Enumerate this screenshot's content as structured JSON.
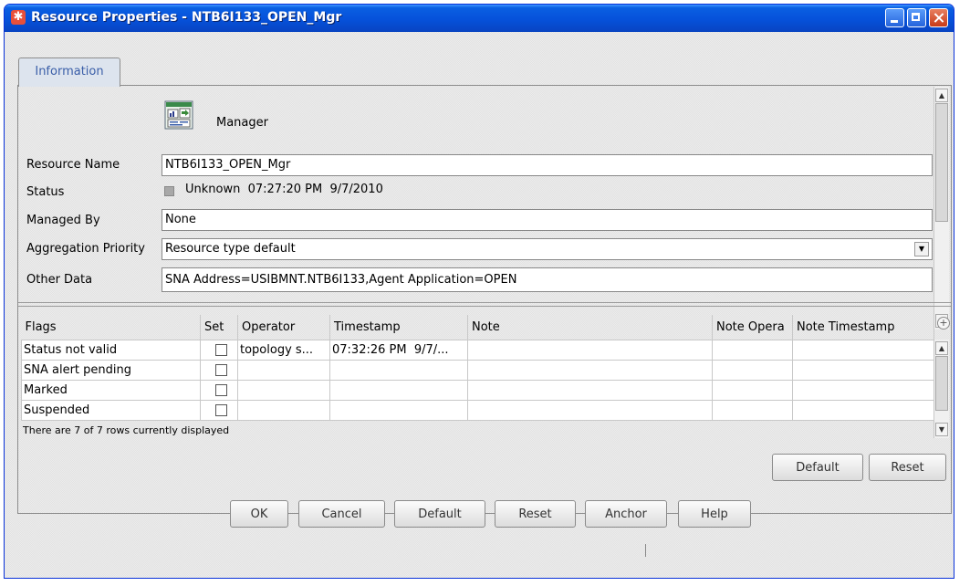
{
  "window": {
    "title": "Resource Properties - NTB6I133_OPEN_Mgr"
  },
  "tabs": [
    {
      "label": "Information"
    }
  ],
  "info": {
    "type_label": "Manager",
    "resource_name_label": "Resource Name",
    "resource_name_value": "NTB6I133_OPEN_Mgr",
    "status_label": "Status",
    "status_value": "Unknown  07:27:20 PM  9/7/2010",
    "status_color": "#a8a8a8",
    "managed_by_label": "Managed By",
    "managed_by_value": "None",
    "aggregation_priority_label": "Aggregation Priority",
    "aggregation_priority_value": "Resource type default",
    "other_data_label": "Other Data",
    "other_data_value": "SNA Address=USIBMNT.NTB6I133,Agent Application=OPEN"
  },
  "flags_table": {
    "columns": [
      "Flags",
      "Set",
      "Operator",
      "Timestamp",
      "Note",
      "Note Opera",
      "Note Timestamp"
    ],
    "rows": [
      {
        "flag": "Status not valid",
        "set": false,
        "operator": "topology s...",
        "timestamp": "07:32:26 PM  9/7/...",
        "note": "",
        "note_operator": "",
        "note_timestamp": ""
      },
      {
        "flag": "SNA alert pending",
        "set": false,
        "operator": "",
        "timestamp": "",
        "note": "",
        "note_operator": "",
        "note_timestamp": ""
      },
      {
        "flag": "Marked",
        "set": false,
        "operator": "",
        "timestamp": "",
        "note": "",
        "note_operator": "",
        "note_timestamp": ""
      },
      {
        "flag": "Suspended",
        "set": false,
        "operator": "",
        "timestamp": "",
        "note": "",
        "note_operator": "",
        "note_timestamp": ""
      }
    ],
    "footer": "There are 7 of 7 rows currently displayed",
    "default_label": "Default",
    "reset_label": "Reset"
  },
  "buttons": {
    "ok": "OK",
    "cancel": "Cancel",
    "default": "Default",
    "reset": "Reset",
    "anchor": "Anchor",
    "help": "Help"
  }
}
